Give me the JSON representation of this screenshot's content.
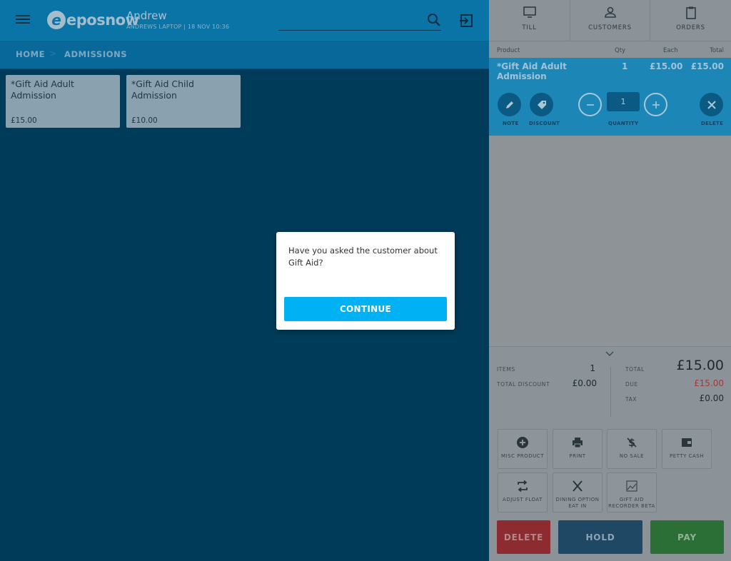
{
  "header": {
    "brand": "eposnow",
    "user_name": "Andrew",
    "user_sub": "ANDREWS LAPTOP | 18 NOV 10:36"
  },
  "breadcrumb": {
    "home": "HOME",
    "separator": ">",
    "current": "ADMISSIONS"
  },
  "products": [
    {
      "name": "*Gift Aid Adult Admission",
      "price": "£15.00"
    },
    {
      "name": "*Gift Aid Child Admission",
      "price": "£10.00"
    }
  ],
  "right_nav": {
    "till": "TILL",
    "customers": "CUSTOMERS",
    "orders": "ORDERS"
  },
  "cart_headers": {
    "product": "Product",
    "qty": "Qty",
    "each": "Each",
    "total": "Total"
  },
  "cart_line": {
    "name": "*Gift Aid Adult Admission",
    "qty": "1",
    "each": "£15.00",
    "total": "£15.00",
    "quantity_value": "1",
    "note_label": "NOTE",
    "discount_label": "DISCOUNT",
    "quantity_label": "QUANTITY",
    "delete_label": "DELETE"
  },
  "totals": {
    "items_label": "ITEMS",
    "items_value": "1",
    "total_discount_label": "TOTAL DISCOUNT",
    "total_discount_value": "£0.00",
    "total_label": "TOTAL",
    "total_value": "£15.00",
    "due_label": "DUE",
    "due_value": "£15.00",
    "tax_label": "TAX",
    "tax_value": "£0.00"
  },
  "functions": {
    "misc_product": "MISC PRODUCT",
    "print": "PRINT",
    "no_sale": "NO SALE",
    "petty_cash": "PETTY CASH",
    "adjust_float": "ADJUST FLOAT",
    "dining_option_1": "DINING OPTION",
    "dining_option_2": "EAT IN",
    "gift_aid_1": "GIFT AID",
    "gift_aid_2": "RECORDER BETA"
  },
  "actions": {
    "delete": "DELETE",
    "hold": "HOLD",
    "pay": "PAY"
  },
  "modal": {
    "message": "Have you asked the customer about Gift Aid?",
    "continue": "CONTINUE"
  },
  "colors": {
    "accent": "#00b2f4",
    "due_red": "#a33a3a",
    "pay_green": "#2b6f36",
    "delete_red": "#8d2c30",
    "hold_blue": "#1f4865"
  }
}
